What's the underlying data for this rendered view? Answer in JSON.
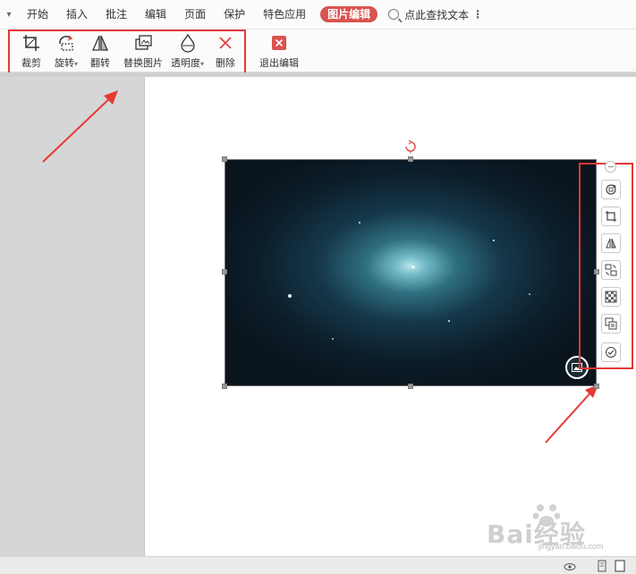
{
  "menu": {
    "items": [
      {
        "label": "开始"
      },
      {
        "label": "插入"
      },
      {
        "label": "批注"
      },
      {
        "label": "编辑"
      },
      {
        "label": "页面"
      },
      {
        "label": "保护"
      },
      {
        "label": "特色应用"
      }
    ],
    "active_tab": "图片编辑",
    "search_label": "点此查找文本"
  },
  "ribbon": {
    "crop": "裁剪",
    "rotate": "旋转",
    "flip": "翻转",
    "replace": "替换图片",
    "transparency": "透明度",
    "delete": "删除",
    "exit": "退出编辑"
  },
  "colors": {
    "accent_red": "#e53935",
    "active_tab_bg": "#d9534f",
    "image_bg": "#0b1621"
  },
  "side_toolbar": {
    "icons": [
      "rotate-image-icon",
      "crop-icon",
      "flip-icon",
      "replace-icon",
      "transparency-icon",
      "ocr-icon",
      "confirm-icon"
    ]
  },
  "watermark": {
    "brand": "Bai经验",
    "sub": "jingyan.baidu.com"
  }
}
